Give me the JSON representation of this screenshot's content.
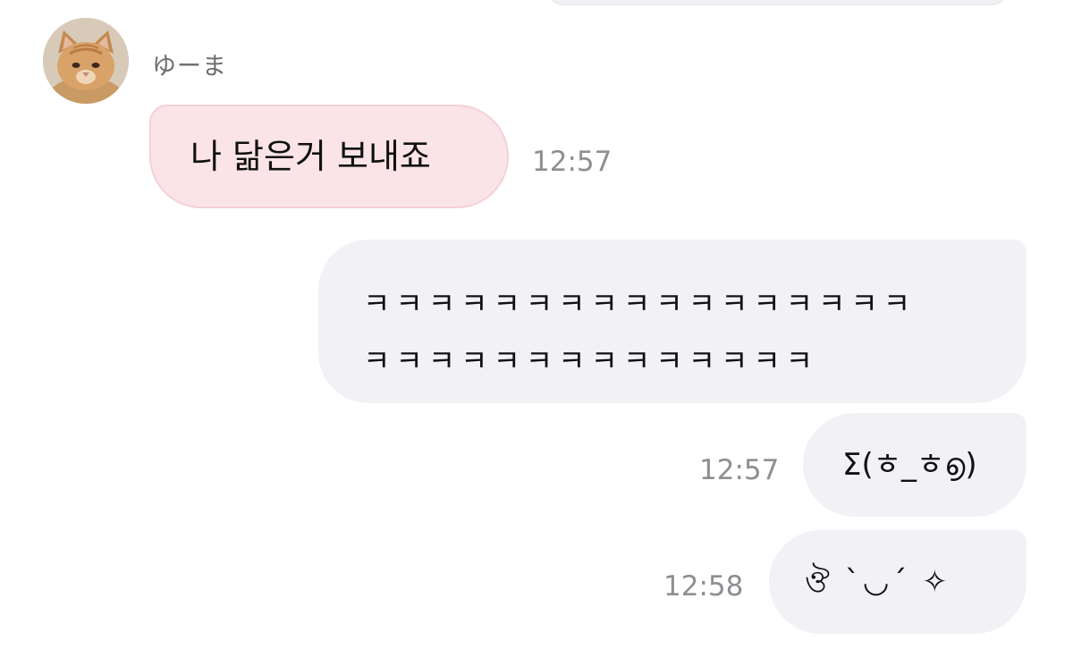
{
  "sender": {
    "name": "ゆーま",
    "avatar_icon": "cat-photo-icon"
  },
  "messages": [
    {
      "direction": "incoming",
      "text": "나 닮은거 보내죠",
      "time": "12:57"
    },
    {
      "direction": "outgoing",
      "lines": [
        "ㅋㅋㅋㅋㅋㅋㅋㅋㅋㅋㅋㅋㅋㅋㅋㅋㅋ",
        "ㅋㅋㅋㅋㅋㅋㅋㅋㅋㅋㅋㅋㅋㅋ"
      ]
    },
    {
      "direction": "outgoing",
      "text": "Σ(ㅎ_ㅎ൭)",
      "time": "12:57"
    },
    {
      "direction": "outgoing",
      "text": "ঔ ˋ◡ˊ ✧",
      "time": "12:58"
    }
  ],
  "colors": {
    "incoming_bubble": "#fbe4e8",
    "incoming_border": "#f4d0d8",
    "outgoing_bubble": "#f2f2f6",
    "timestamp": "#8e8e93",
    "sender_name": "#6b6b6b"
  }
}
